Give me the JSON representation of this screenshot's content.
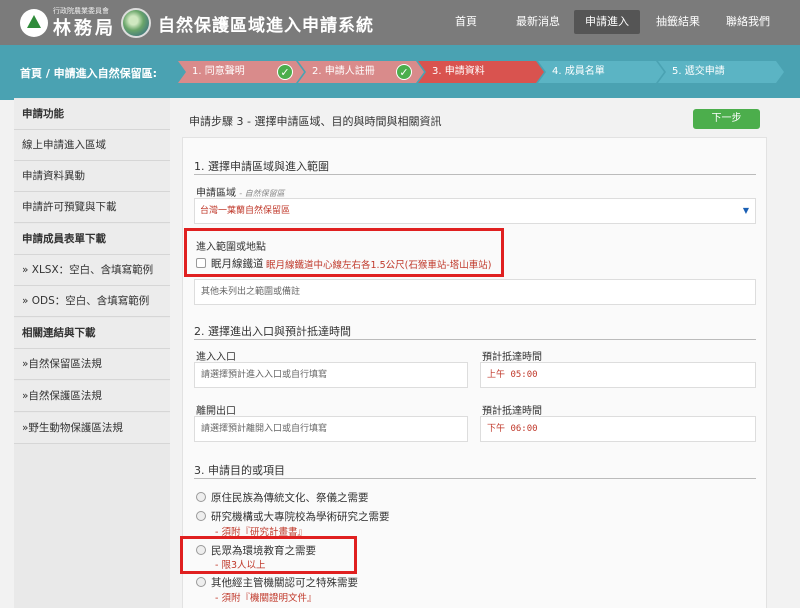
{
  "header": {
    "logo_small": "行政院農業委員會",
    "logo_name": "林務局",
    "site_title": "自然保護區域進入申請系統",
    "nav": [
      {
        "label": "首頁",
        "active": false
      },
      {
        "label": "最新消息",
        "active": false
      },
      {
        "label": "申請進入",
        "active": true
      },
      {
        "label": "抽籤結果",
        "active": false
      },
      {
        "label": "聯絡我們",
        "active": false
      }
    ]
  },
  "stepbar": {
    "crumb": "首頁 / 申請進入自然保留區:",
    "steps": [
      {
        "label": "1. 同意聲明",
        "done": true,
        "state": "done"
      },
      {
        "label": "2. 申請人註冊",
        "done": true,
        "state": "done"
      },
      {
        "label": "3. 申請資料",
        "done": false,
        "state": "current"
      },
      {
        "label": "4. 成員名單",
        "done": false,
        "state": "todo"
      },
      {
        "label": "5. 遞交申請",
        "done": false,
        "state": "todo"
      }
    ],
    "colors": {
      "done": "#d98b8b",
      "current": "#d9534f",
      "todo": "#5bb4c4"
    }
  },
  "sidebar": {
    "items": [
      {
        "label": "申請功能",
        "head": true
      },
      {
        "label": "線上申請進入區域",
        "head": false
      },
      {
        "label": "申請資料異動",
        "head": false
      },
      {
        "label": "申請許可預覽與下載",
        "head": false
      },
      {
        "label": "申請成員表單下載",
        "head": true
      },
      {
        "label": "» XLSX：空白、含填寫範例",
        "head": false
      },
      {
        "label": "» ODS：空白、含填寫範例",
        "head": false
      },
      {
        "label": "相關連結與下載",
        "head": true
      },
      {
        "label": "»自然保留區法規",
        "head": false
      },
      {
        "label": "»自然保護區法規",
        "head": false
      },
      {
        "label": "»野生動物保護區法規",
        "head": false
      }
    ]
  },
  "main": {
    "title": "申請步驟 3 - 選擇申請區域、目的與時間與相關資訊",
    "next_label": "下一步",
    "section1": {
      "title": "1. 選擇申請區域與進入範圍",
      "area_label": "申請區域",
      "area_hint": "- 自然保留區",
      "area_value": "台灣一葉蘭自然保留區",
      "range_label": "進入範圍或地點",
      "range_option": "眠月線鐵道",
      "range_detail": "眠月線鐵道中心線左右各1.5公尺(石猴車站-塔山車站)",
      "other_placeholder": "其他未列出之範圍或備註"
    },
    "section2": {
      "title": "2. 選擇進出入口與預計抵達時間",
      "entry_label": "進入入口",
      "entry_placeholder": "請選擇預計進入入口或自行填寫",
      "arrive_label": "預計抵達時間",
      "arrive_ampm": "上午",
      "arrive_time": "05:00",
      "exit_label": "離開出口",
      "exit_placeholder": "請選擇預計離開入口或自行填寫",
      "leave_label": "預計抵達時間",
      "leave_ampm": "下午",
      "leave_time": "06:00"
    },
    "section3": {
      "title": "3. 申請目的或項目",
      "options": [
        {
          "label": "原住民族為傳統文化、祭儀之需要",
          "note": ""
        },
        {
          "label": "研究機構或大專院校為學術研究之需要",
          "note": "- 須附『研究計畫書』"
        },
        {
          "label": "民眾為環境教育之需要",
          "note": "- 限3人以上"
        },
        {
          "label": "其他經主管機關認可之特殊需要",
          "note": "- 須附『機關證明文件』"
        }
      ]
    }
  }
}
